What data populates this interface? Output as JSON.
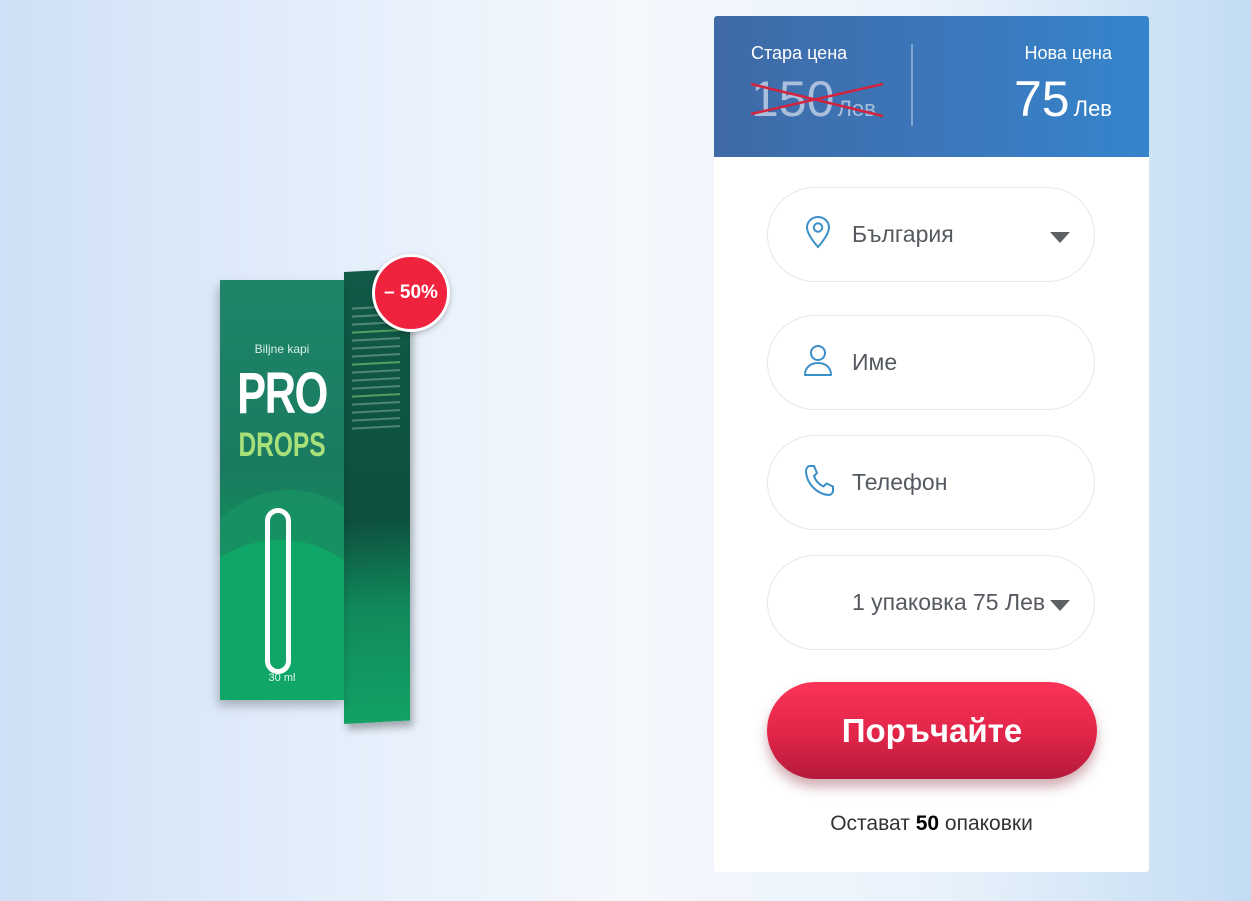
{
  "product": {
    "box_subtitle": "Biljne kapi",
    "box_brand_top": "PRO",
    "box_brand_bottom": "DROPS",
    "box_volume": "30 ml",
    "discount_badge": "– 50%",
    "colors": {
      "box_green": "#1a7a60",
      "badge_red": "#f0233f",
      "drops_lime": "#a8e07a"
    }
  },
  "prices": {
    "old_caption": "Стара цена",
    "old_value": "150",
    "old_currency": "Лев",
    "new_caption": "Нова цена",
    "new_value": "75",
    "new_currency": "Лев",
    "header_color": "#3b79bd"
  },
  "form": {
    "country": {
      "value": "България",
      "icon": "map-pin-icon"
    },
    "name": {
      "placeholder": "Име",
      "icon": "user-icon"
    },
    "phone": {
      "placeholder": "Телефон",
      "icon": "phone-icon"
    },
    "package": {
      "value": "1 упаковка 75 Лев"
    },
    "submit_label": "Поръчайте",
    "submit_color": "#e02549"
  },
  "stock": {
    "prefix": "Остават",
    "count": "50",
    "suffix": "опаковки"
  }
}
